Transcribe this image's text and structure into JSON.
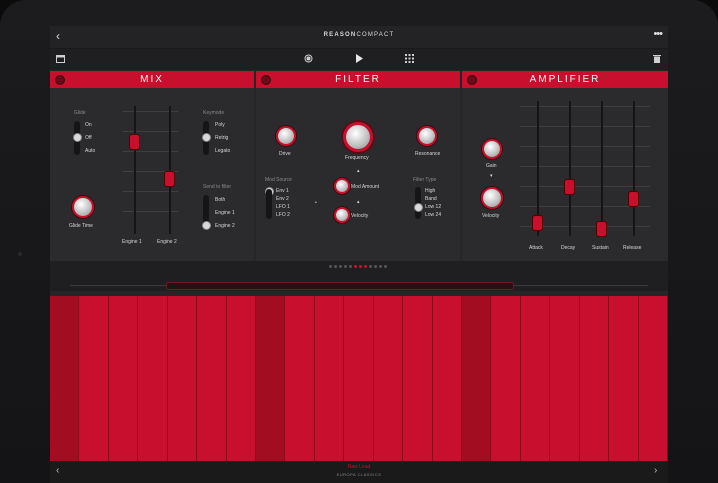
{
  "app": {
    "brand_bold": "REASON",
    "brand_light": "COMPACT"
  },
  "topbar": {
    "back_icon": "chevron-left-icon",
    "menu_icon": "more-dots-icon"
  },
  "toolbar": {
    "left_icon": "calendar-icon",
    "record_icon": "record-icon",
    "play_icon": "play-icon",
    "grid_icon": "grid-icon",
    "trash_icon": "trash-icon"
  },
  "mix": {
    "title": "MIX",
    "glide": {
      "label": "Glide",
      "options": [
        "On",
        "Off",
        "Auto"
      ],
      "selected": "Off"
    },
    "glide_time_label": "Glide Time",
    "engine1_label": "Engine 1",
    "engine2_label": "Engine 2",
    "engine1_level": 0.75,
    "engine2_level": 0.42,
    "keymode": {
      "label": "Keymode",
      "options": [
        "Poly",
        "Retrig",
        "Legato"
      ],
      "selected": "Retrig"
    },
    "send_to_filter": {
      "label": "Send to filter",
      "options": [
        "Both",
        "Engine 1",
        "Engine 2"
      ],
      "selected": "Engine 2"
    }
  },
  "filter": {
    "title": "FILTER",
    "drive_label": "Drive",
    "frequency_label": "Frequency",
    "resonance_label": "Resonance",
    "mod_source": {
      "label": "Mod Source",
      "options": [
        "Env 1",
        "Env 2",
        "LFO 1",
        "LFO 2"
      ],
      "selected": "Env 1"
    },
    "mod_amount_label": "Mod Amount",
    "velocity_label": "Velocity",
    "filter_type": {
      "label": "Filter Type",
      "options": [
        "High",
        "Band",
        "Low 12",
        "Low 24"
      ],
      "selected": "Low 12"
    }
  },
  "amplifier": {
    "title": "AMPLIFIER",
    "gain_label": "Gain",
    "velocity_label": "Velocity",
    "adsr": [
      {
        "label": "Attack",
        "value": 0.05
      },
      {
        "label": "Decay",
        "value": 0.35
      },
      {
        "label": "Sustain",
        "value": 0.0
      },
      {
        "label": "Release",
        "value": 0.25
      }
    ]
  },
  "pager": {
    "count": 12,
    "active": [
      5,
      6,
      7
    ]
  },
  "keyboard": {
    "white_keys": 21,
    "dark_keys": [
      0,
      7,
      14
    ]
  },
  "bottombar": {
    "patch_name": "Raw Lead",
    "bank_name": "EUROPA CLASSICS",
    "prev_icon": "chevron-left-icon",
    "next_icon": "chevron-right-icon"
  },
  "colors": {
    "accent": "#c8102e",
    "panel": "#2b2b2d",
    "background": "#262628"
  }
}
